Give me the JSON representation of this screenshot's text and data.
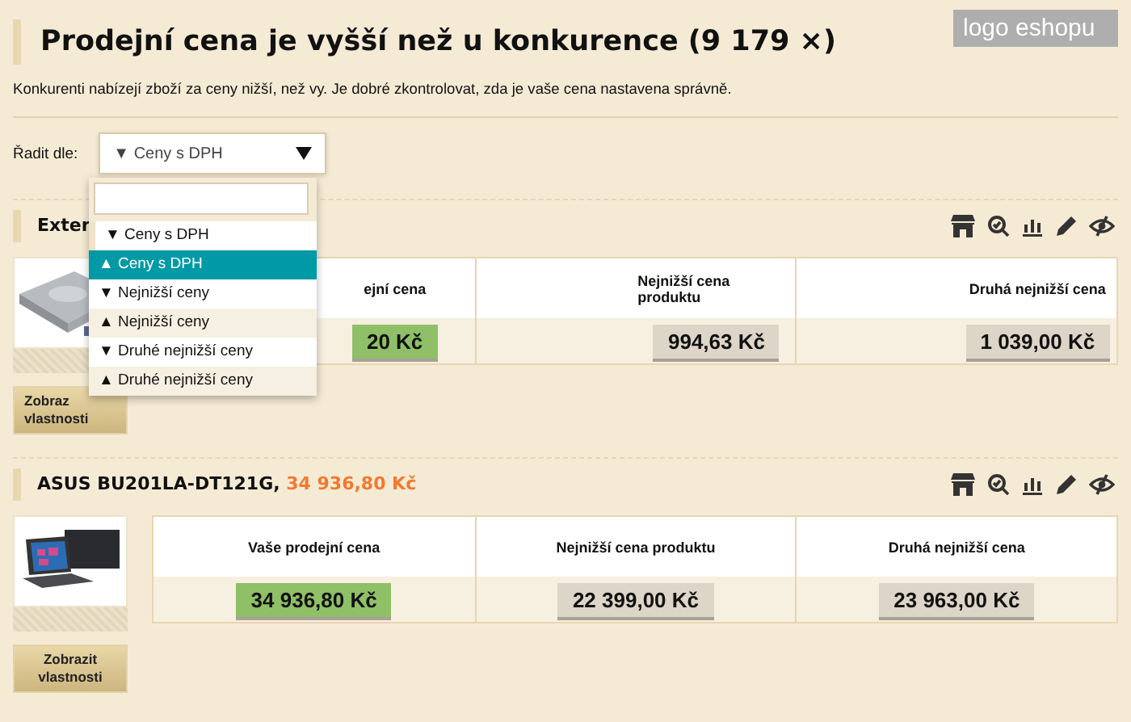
{
  "header": {
    "title": "Prodejní cena je vyšší než u konkurence (9 179 ×)",
    "logo": "logo eshopu",
    "description": "Konkurenti nabízejí zboží za ceny nižší, než vy. Je dobré zkontrolovat, zda je vaše cena nastavena správně."
  },
  "sort": {
    "label": "Řadit dle:",
    "value": "▼ Ceny s DPH",
    "expanded": true,
    "options": [
      {
        "label": "▼ Ceny s DPH",
        "selected": true,
        "highlighted": false
      },
      {
        "label": "▲ Ceny s DPH",
        "selected": false,
        "highlighted": true
      },
      {
        "label": "▼ Nejnižší ceny",
        "selected": false,
        "highlighted": false
      },
      {
        "label": "▲ Nejnižší ceny",
        "selected": false,
        "highlighted": false
      },
      {
        "label": "▼ Druhé nejnižší ceny",
        "selected": false,
        "highlighted": false
      },
      {
        "label": "▲ Druhé nejnižší ceny",
        "selected": false,
        "highlighted": false
      }
    ]
  },
  "products": [
    {
      "name": "Exter",
      "button": "Zobraz vlastnosti",
      "columns": [
        {
          "header": "ejní cena",
          "value": "20 Kč",
          "kind": "own"
        },
        {
          "header": "Nejnižší cena produktu",
          "value": "994,63 Kč",
          "kind": "competitor"
        },
        {
          "header": "Druhá nejnižší cena",
          "value": "1 039,00 Kč",
          "kind": "competitor"
        }
      ]
    },
    {
      "name": "ASUS BU201LA-DT121G,",
      "price": "34 936,80 Kč",
      "button": "Zobrazit vlastnosti",
      "columns": [
        {
          "header": "Vaše prodejní cena",
          "value": "34 936,80 Kč",
          "kind": "own"
        },
        {
          "header": "Nejnižší cena produktu",
          "value": "22 399,00 Kč",
          "kind": "competitor"
        },
        {
          "header": "Druhá nejnižší cena",
          "value": "23 963,00 Kč",
          "kind": "competitor"
        }
      ]
    }
  ]
}
